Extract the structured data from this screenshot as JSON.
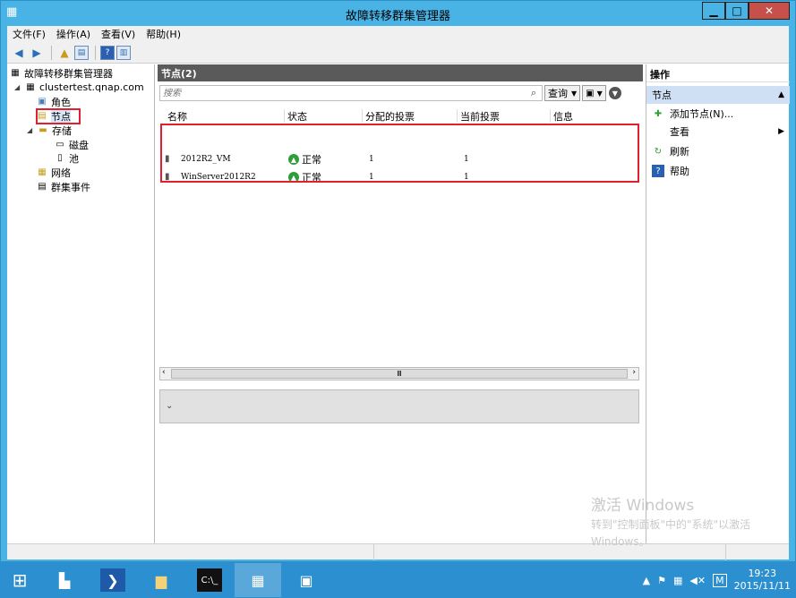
{
  "window": {
    "title": "故障转移群集管理器",
    "minimize": "▁",
    "maximize": "□",
    "close": "✕"
  },
  "menubar": {
    "items": [
      "文件(F)",
      "操作(A)",
      "查看(V)",
      "帮助(H)"
    ]
  },
  "tree": {
    "root": "故障转移群集管理器",
    "cluster": "clustertest.qnap.com",
    "roles": "角色",
    "nodes": "节点",
    "storage": "存储",
    "disks": "磁盘",
    "pools": "池",
    "networks": "网络",
    "events": "群集事件"
  },
  "center": {
    "header": "节点(2)",
    "search_placeholder": "搜索",
    "query_label": "查询",
    "columns": [
      "名称",
      "状态",
      "分配的投票",
      "当前投票",
      "信息"
    ],
    "rows": [
      {
        "name": "2012R2_VM",
        "status": "正常",
        "assigned_vote": "1",
        "current_vote": "1"
      },
      {
        "name": "WinServer2012R2",
        "status": "正常",
        "assigned_vote": "1",
        "current_vote": "1"
      }
    ],
    "scroll_thumb_label": "Ⅲ"
  },
  "actions": {
    "title": "操作",
    "section": "节点",
    "items": [
      {
        "label": "添加节点(N)...",
        "icon": "add-node-icon"
      },
      {
        "label": "查看",
        "icon": ""
      },
      {
        "label": "刷新",
        "icon": "refresh-icon"
      },
      {
        "label": "帮助",
        "icon": "help-icon"
      }
    ]
  },
  "watermark": {
    "line1": "激活 Windows",
    "line2": "转到\"控制面板\"中的\"系统\"以激活",
    "line3": "Windows。"
  },
  "taskbar": {
    "time": "19:23",
    "date": "2015/11/11"
  }
}
